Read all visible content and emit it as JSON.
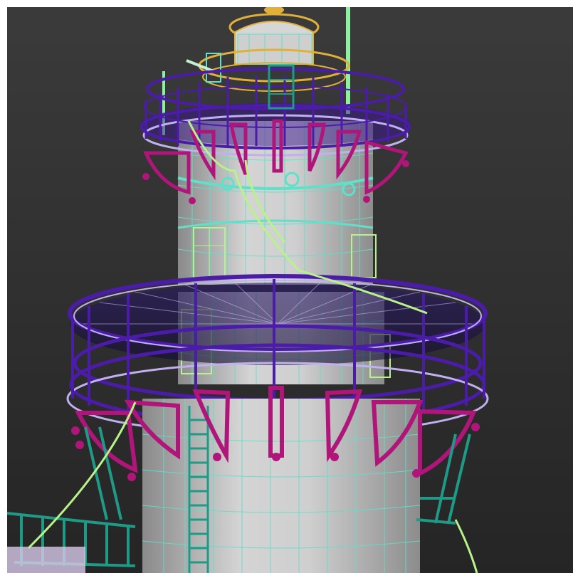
{
  "scene": {
    "subject": "wireframe-lighthouse",
    "colors": {
      "background_top": "#3a3a3a",
      "background_bottom": "#262626",
      "tower_fill": "#c9c9c9",
      "tower_shade": "#8e8e8e",
      "wire_cyan": "#5fe0c8",
      "wire_teal": "#1f9a86",
      "rail_purple": "#4b1ca8",
      "rail_violet": "#7a2ed0",
      "bracket_magenta": "#b0157a",
      "bracket_pink": "#e65aa8",
      "lantern_gold": "#e0b03a",
      "cable_green": "#b8f28a",
      "deck_purple": "#3a1690"
    }
  }
}
